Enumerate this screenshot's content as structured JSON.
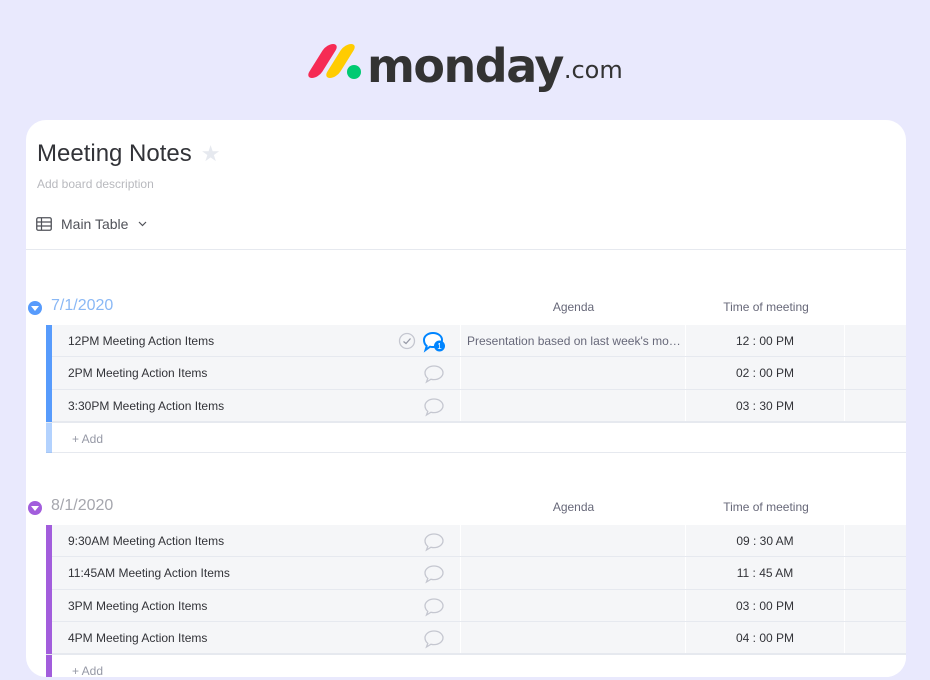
{
  "brand": {
    "wordmark": "monday",
    "suffix": ".com",
    "colors": {
      "red": "#f62b54",
      "yellow": "#ffcc00",
      "green": "#00ca72",
      "text": "#333333"
    }
  },
  "board": {
    "title": "Meeting Notes",
    "star_icon": "star-icon",
    "description_placeholder": "Add board description",
    "view": {
      "label": "Main Table",
      "icon": "table-icon",
      "dropdown_icon": "chevron-down-icon"
    }
  },
  "columns": {
    "agenda": "Agenda",
    "time": "Time of meeting"
  },
  "groups": [
    {
      "title": "7/1/2020",
      "color": "#579bfc",
      "title_color": "#8ab8f5",
      "add_label": "+ Add",
      "items": [
        {
          "name": "12PM Meeting Action Items",
          "agenda": "Presentation based on last week's mont...",
          "time": "12 : 00 PM",
          "has_updates": true,
          "update_count": "1"
        },
        {
          "name": "2PM Meeting Action Items",
          "agenda": "",
          "time": "02 : 00 PM",
          "has_updates": false
        },
        {
          "name": "3:30PM Meeting Action Items",
          "agenda": "",
          "time": "03 : 30 PM",
          "has_updates": false
        }
      ]
    },
    {
      "title": "8/1/2020",
      "color": "#a25ddc",
      "title_color": "#a5a6ad",
      "add_label": "+ Add",
      "items": [
        {
          "name": "9:30AM Meeting Action Items",
          "agenda": "",
          "time": "09 : 30 AM",
          "has_updates": false
        },
        {
          "name": "11:45AM Meeting Action Items",
          "agenda": "",
          "time": "11 : 45 AM",
          "has_updates": false
        },
        {
          "name": "3PM Meeting Action Items",
          "agenda": "",
          "time": "03 : 00 PM",
          "has_updates": false
        },
        {
          "name": "4PM Meeting Action Items",
          "agenda": "",
          "time": "04 : 00 PM",
          "has_updates": false
        }
      ]
    }
  ]
}
